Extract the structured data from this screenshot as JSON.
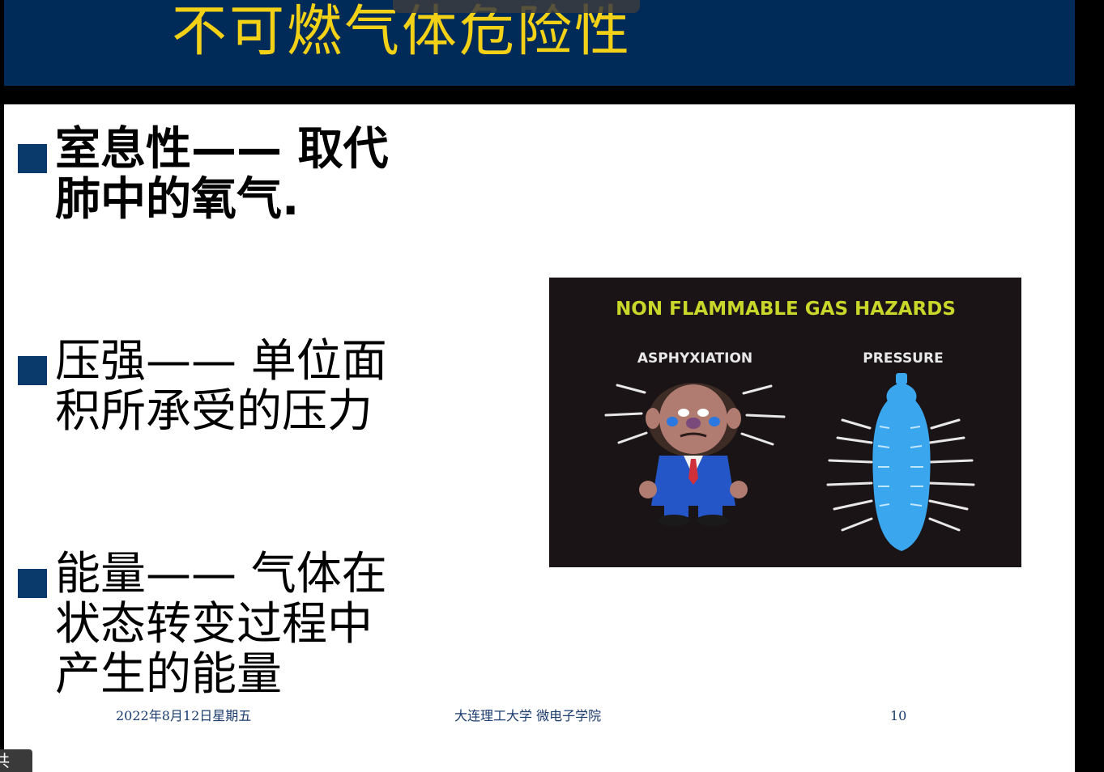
{
  "slide": {
    "title": "不可燃气体危险性",
    "bullets": [
      {
        "text": "室息性—— 取代肺中的氧气."
      },
      {
        "text": "压强—— 单位面积所承受的压力"
      },
      {
        "text": "能量—— 气体在状态转变过程中产生的能量"
      }
    ],
    "illustration": {
      "heading": "NON FLAMMABLE GAS HAZARDS",
      "left_label": "ASPHYXIATION",
      "right_label": "PRESSURE"
    },
    "footer": {
      "date": "2022年8月12日星期五",
      "org": "大连理工大学  微电子学院",
      "page": "10"
    }
  },
  "overlay": {
    "share_label": "共享"
  },
  "colors": {
    "header_bg": "#002a57",
    "title": "#f2d116",
    "bullet_square": "#0a3a6b",
    "illus_heading": "#c9d62a",
    "cylinder": "#3aa6ee"
  },
  "icons": {
    "bullet": "square-bullet-icon",
    "person": "crying-man-icon",
    "cylinder": "gas-cylinder-icon"
  }
}
